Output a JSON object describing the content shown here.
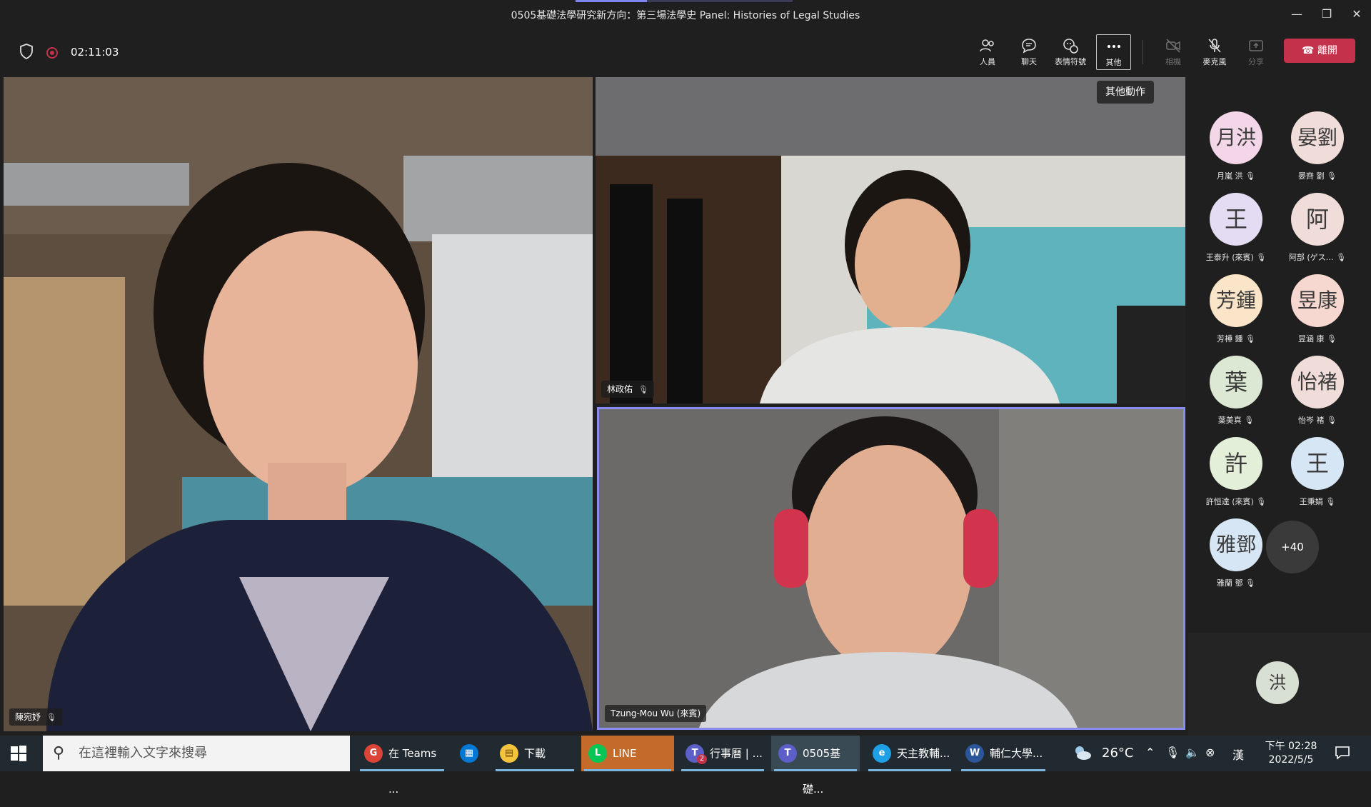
{
  "window": {
    "title": "0505基礎法學研究新方向：第三場法學史 Panel: Histories of Legal Studies"
  },
  "call": {
    "elapsed": "02:11:03",
    "share_progress": 0.33
  },
  "toolbar": {
    "people_label": "人員",
    "chat_label": "聊天",
    "reactions_label": "表情符號",
    "more_label": "其他",
    "camera_label": "相機",
    "mic_label": "麥克風",
    "share_label": "分享",
    "leave_label": "離開",
    "more_tooltip": "其他動作"
  },
  "videos": {
    "main": {
      "name": "陳宛妤"
    },
    "top_right": {
      "name": "林政佑"
    },
    "bottom_right": {
      "name": "Tzung-Mou Wu (來賓)"
    }
  },
  "participants": [
    {
      "initials": "月洪",
      "name": "月嵐 洪",
      "color": "#f3d6e8"
    },
    {
      "initials": "晏劉",
      "name": "晏齊 劉",
      "color": "#f0dcd8"
    },
    {
      "initials": "王",
      "name": "王泰升 (來賓)",
      "color": "#e3dcf2"
    },
    {
      "initials": "阿",
      "name": "阿部 (ゲス…",
      "color": "#f0dcd8"
    },
    {
      "initials": "芳鍾",
      "name": "芳樺 鍾",
      "color": "#fbe5c8"
    },
    {
      "initials": "昱康",
      "name": "昱涵 康",
      "color": "#f7d8d0"
    },
    {
      "initials": "葉",
      "name": "葉美真",
      "color": "#dde8d4"
    },
    {
      "initials": "怡褚",
      "name": "怡岑 褚",
      "color": "#f0dcd8"
    },
    {
      "initials": "許",
      "name": "許恒達 (來賓)",
      "color": "#e4efd9"
    },
    {
      "initials": "王",
      "name": "王秉娟",
      "color": "#d6e6f5"
    },
    {
      "initials": "雅鄧",
      "name": "雅蘭 鄧",
      "color": "#d6e6f5"
    }
  ],
  "overflow": {
    "label": "+40"
  },
  "self_avatar": {
    "initials": "洪"
  },
  "taskbar": {
    "search_placeholder": "在這裡輸入文字來搜尋",
    "apps": [
      {
        "label": "在 Teams ...",
        "icon": "chrome-icon"
      },
      {
        "label": "",
        "icon": "store-icon"
      },
      {
        "label": "下載",
        "icon": "folder-icon"
      },
      {
        "label": "LINE",
        "icon": "line-icon"
      },
      {
        "label": "行事曆 | ...",
        "icon": "teams-icon",
        "badge": "2"
      },
      {
        "label": "0505基礎...",
        "icon": "teams-icon"
      },
      {
        "label": "天主教輔...",
        "icon": "ie-icon"
      },
      {
        "label": "輔仁大學...",
        "icon": "word-icon"
      }
    ],
    "weather": "26°C",
    "time": "下午 02:28",
    "date": "2022/5/5"
  }
}
